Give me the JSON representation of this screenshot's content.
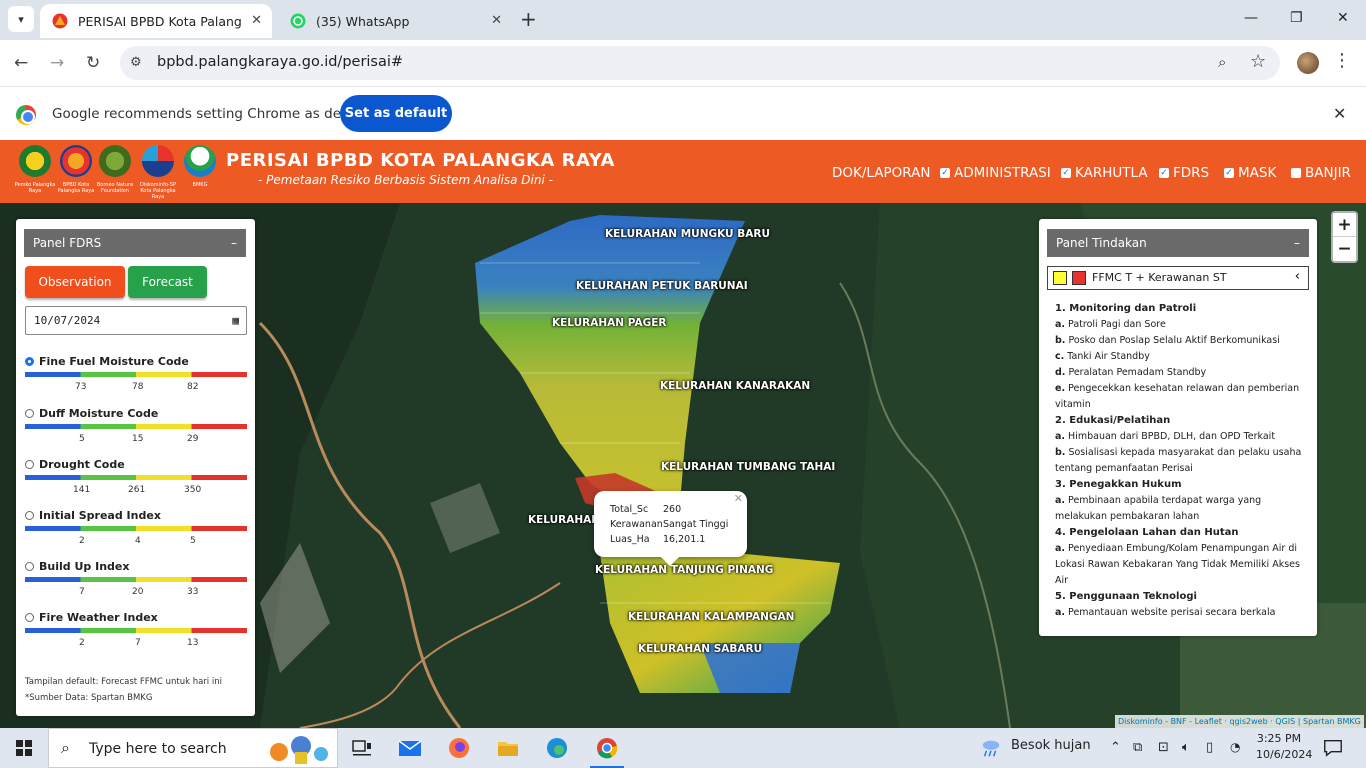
{
  "browser": {
    "tabs": [
      {
        "title": "PERISAI BPBD Kota Palangka Ra"
      },
      {
        "title": "(35) WhatsApp"
      }
    ],
    "url": "bpbd.palangkaraya.go.id/perisai#",
    "infobar": {
      "message": "Google recommends setting Chrome as default",
      "button": "Set as default"
    }
  },
  "site": {
    "title": "PERISAI BPBD KOTA PALANGKA RAYA",
    "subtitle": "- Pemetaan Resiko Berbasis Sistem Analisa Dini -",
    "logos": [
      {
        "caption": "Pemko Palangka Raya"
      },
      {
        "caption": "BPBD Kota Palangka Raya"
      },
      {
        "caption": "Borneo Nature Foundation"
      },
      {
        "caption": "Diskominfo-SP Kota Palangka Raya"
      },
      {
        "caption": "BMKG"
      }
    ],
    "menu": [
      {
        "label": "DOK/LAPORAN",
        "checkbox": false
      },
      {
        "label": "ADMINISTRASI",
        "checkbox": true,
        "checked": true
      },
      {
        "label": "KARHUTLA",
        "checkbox": true,
        "checked": true
      },
      {
        "label": "FDRS",
        "checkbox": true,
        "checked": true
      },
      {
        "label": "MASK",
        "checkbox": true,
        "checked": true
      },
      {
        "label": "BANJIR",
        "checkbox": true,
        "checked": false
      }
    ]
  },
  "panel_fdrs": {
    "title": "Panel FDRS",
    "minimize": "–",
    "observation_label": "Observation",
    "forecast_label": "Forecast",
    "date_value": "10/07/2024",
    "indices": [
      {
        "label": "Fine Fuel Moisture Code",
        "selected": true,
        "ticks": [
          "73",
          "78",
          "82"
        ]
      },
      {
        "label": "Duff Moisture Code",
        "selected": false,
        "ticks": [
          "5",
          "15",
          "29"
        ]
      },
      {
        "label": "Drought Code",
        "selected": false,
        "ticks": [
          "141",
          "261",
          "350"
        ]
      },
      {
        "label": "Initial Spread Index",
        "selected": false,
        "ticks": [
          "2",
          "4",
          "5"
        ]
      },
      {
        "label": "Build Up Index",
        "selected": false,
        "ticks": [
          "7",
          "20",
          "33"
        ]
      },
      {
        "label": "Fire Weather Index",
        "selected": false,
        "ticks": [
          "2",
          "7",
          "13"
        ]
      }
    ],
    "note_default": "Tampilan default: Forecast FFMC untuk hari ini",
    "note_source": "*Sumber Data: Spartan BMKG"
  },
  "map": {
    "kelurahan_labels": [
      "KELURAHAN MUNGKU BARU",
      "KELURAHAN PETUK BARUNAI",
      "KELURAHAN PAGER",
      "KELURAHAN KANARAKAN",
      "KELURAHAN TUMBANG TAHAI",
      "KELURAHAN",
      "KELURAHAN TANJUNG PINANG",
      "KELURAHAN KALAMPANGAN",
      "KELURAHAN SABARU"
    ],
    "popup": {
      "rows": [
        {
          "key": "Total_Sc",
          "value": "260"
        },
        {
          "key": "Kerawanan",
          "value": "Sangat Tinggi"
        },
        {
          "key": "Luas_Ha",
          "value": "16,201.1"
        }
      ]
    },
    "zoom_in": "+",
    "zoom_out": "−",
    "attribution": "Diskominfo - BNF - Leaflet · qgis2web · QGIS | Spartan BMKG"
  },
  "panel_tindakan": {
    "title": "Panel Tindakan",
    "minimize": "–",
    "selector_text": "FFMC T + Kerawanan ST",
    "swatch_colors": [
      "#ffff33",
      "#e8322d"
    ],
    "items": [
      {
        "heading": "1. Monitoring dan Patroli"
      },
      {
        "letter": "a.",
        "text": " Patroli Pagi dan Sore"
      },
      {
        "letter": "b.",
        "text": " Posko dan Poslap Selalu Aktif Berkomunikasi"
      },
      {
        "letter": "c.",
        "text": " Tanki Air Standby"
      },
      {
        "letter": "d.",
        "text": " Peralatan Pemadam Standby"
      },
      {
        "letter": "e.",
        "text": " Pengecekkan kesehatan relawan dan pemberian vitamin"
      },
      {
        "heading": "2. Edukasi/Pelatihan"
      },
      {
        "letter": "a.",
        "text": " Himbauan dari BPBD, DLH, dan OPD Terkait"
      },
      {
        "letter": "b.",
        "text": " Sosialisasi kepada masyarakat dan pelaku usaha tentang pemanfaatan Perisai"
      },
      {
        "heading": "3. Penegakkan Hukum"
      },
      {
        "letter": "a.",
        "text": " Pembinaan apabila terdapat warga yang melakukan pembakaran lahan"
      },
      {
        "heading": "4. Pengelolaan Lahan dan Hutan"
      },
      {
        "letter": "a.",
        "text": " Penyediaan Embung/Kolam Penampungan Air di Lokasi Rawan Kebakaran Yang Tidak Memiliki Akses Air"
      },
      {
        "heading": "5. Penggunaan Teknologi"
      },
      {
        "letter": "a.",
        "text": " Pemantauan website perisai secara berkala"
      }
    ]
  },
  "taskbar": {
    "search_placeholder": "Type here to search",
    "weather": "Besok hujan",
    "time": "3:25 PM",
    "date": "10/6/2024"
  }
}
